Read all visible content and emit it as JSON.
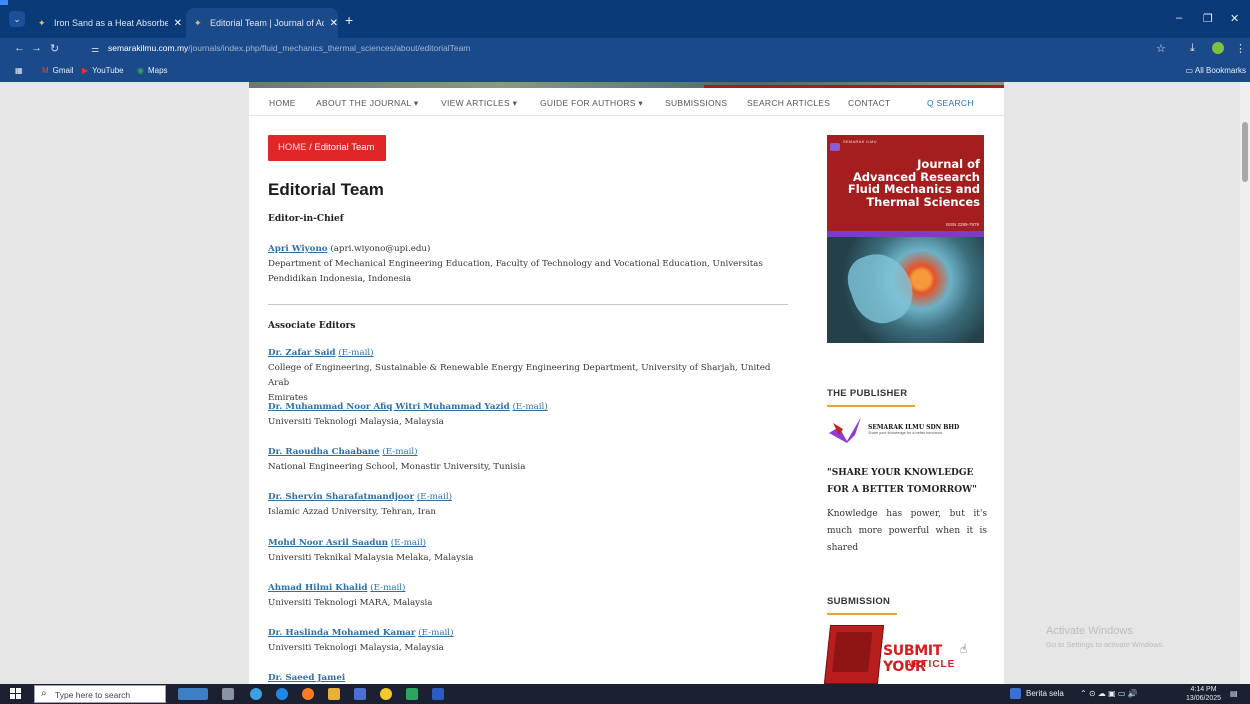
{
  "browser": {
    "tabs": [
      {
        "title": "Iron Sand as a Heat Absorber to",
        "close": "✕"
      },
      {
        "title": "Editorial Team | Journal of Adv...",
        "close": "✕"
      }
    ],
    "new_tab": "+",
    "window_controls": {
      "minimize": "–",
      "restore": "❐",
      "close": "✕"
    },
    "url_host": "semarakilmu.com.my",
    "url_path": "/journals/index.php/fluid_mechanics_thermal_sciences/about/editorialTeam",
    "bookmarks": [
      {
        "icon": "gmail-icon",
        "label": "Gmail"
      },
      {
        "icon": "youtube-icon",
        "label": "YouTube"
      },
      {
        "icon": "maps-icon",
        "label": "Maps"
      }
    ],
    "all_bookmarks": "All Bookmarks"
  },
  "nav": {
    "items": [
      "HOME",
      "ABOUT THE JOURNAL ▾",
      "VIEW ARTICLES ▾",
      "GUIDE FOR AUTHORS ▾",
      "SUBMISSIONS",
      "SEARCH ARTICLES",
      "CONTACT"
    ],
    "search": "Q SEARCH"
  },
  "breadcrumb": {
    "home": "HOME",
    "sep": " / ",
    "current": "Editorial Team"
  },
  "page_title": "Editorial Team",
  "editor_in_chief": {
    "heading": "Editor-in-Chief",
    "name": "Apri Wiyono",
    "email": "(apri.wiyono@upi.edu)",
    "affiliation_1": "Department of Mechanical Engineering Education, Faculty of Technology and Vocational Education, Universitas",
    "affiliation_2": "Pendidikan Indonesia, Indonesia"
  },
  "associate": {
    "heading": "Associate Editors",
    "email_label": "(E-mail)",
    "editors": [
      {
        "name": "Dr. Zafar Said",
        "aff1": "College of Engineering, Sustainable & Renewable Energy Engineering Department, University of Sharjah, United Arab",
        "aff2": "Emirates"
      },
      {
        "name": "Dr. Muhammad Noor Afiq Witri Muhammad Yazid",
        "aff1": "Universiti Teknologi Malaysia, Malaysia"
      },
      {
        "name": "Dr. Raoudha Chaabane",
        "aff1": "National Engineering School, Monastir University, Tunisia"
      },
      {
        "name": "Dr. Shervin Sharafatmandjoor",
        "aff1": "Islamic Azzad University, Tehran, Iran"
      },
      {
        "name": "Mohd Noor Asril Saadun",
        "aff1": "Universiti Teknikal Malaysia Melaka, Malaysia"
      },
      {
        "name": "Ahmad Hilmi Khalid",
        "aff1": "Universiti Teknologi MARA, Malaysia"
      },
      {
        "name": "Dr. Haslinda Mohamed Kamar",
        "aff1": "Universiti Teknologi Malaysia, Malaysia"
      },
      {
        "name": "Dr. Saeed Jamei"
      }
    ]
  },
  "cover": {
    "publisher": "SEMARAK ILMU",
    "title_lines": [
      "Journal of",
      "Advanced Research",
      "Fluid Mechanics and",
      "Thermal Sciences"
    ],
    "issn": "ISSN 2289-7879"
  },
  "sidebar": {
    "publisher_heading": "THE PUBLISHER",
    "publisher_name": "SEMARAK ILMU SDN BHD",
    "publisher_tag": "Share your knowledge for a better tomorrow",
    "quote": "\"SHARE YOUR KNOWLEDGE FOR A BETTER TOMORROW\"",
    "paragraph": "Knowledge has power, but it's much more powerful when it is shared",
    "submission_heading": "SUBMISSION",
    "submit_line1": "SUBMIT YOUR",
    "submit_line2": "ARTICLE"
  },
  "watermark": {
    "line1": "Activate Windows",
    "line2": "Go to Settings to activate Windows."
  },
  "taskbar": {
    "search_placeholder": "Type here to search",
    "news": "Berita sela",
    "time": "4:14 PM",
    "date": "13/06/2025"
  },
  "colors": {
    "accent": "#e12626",
    "link": "#2f6fa6",
    "browser": "#1b4a8a",
    "underline": "#e9a62a"
  }
}
